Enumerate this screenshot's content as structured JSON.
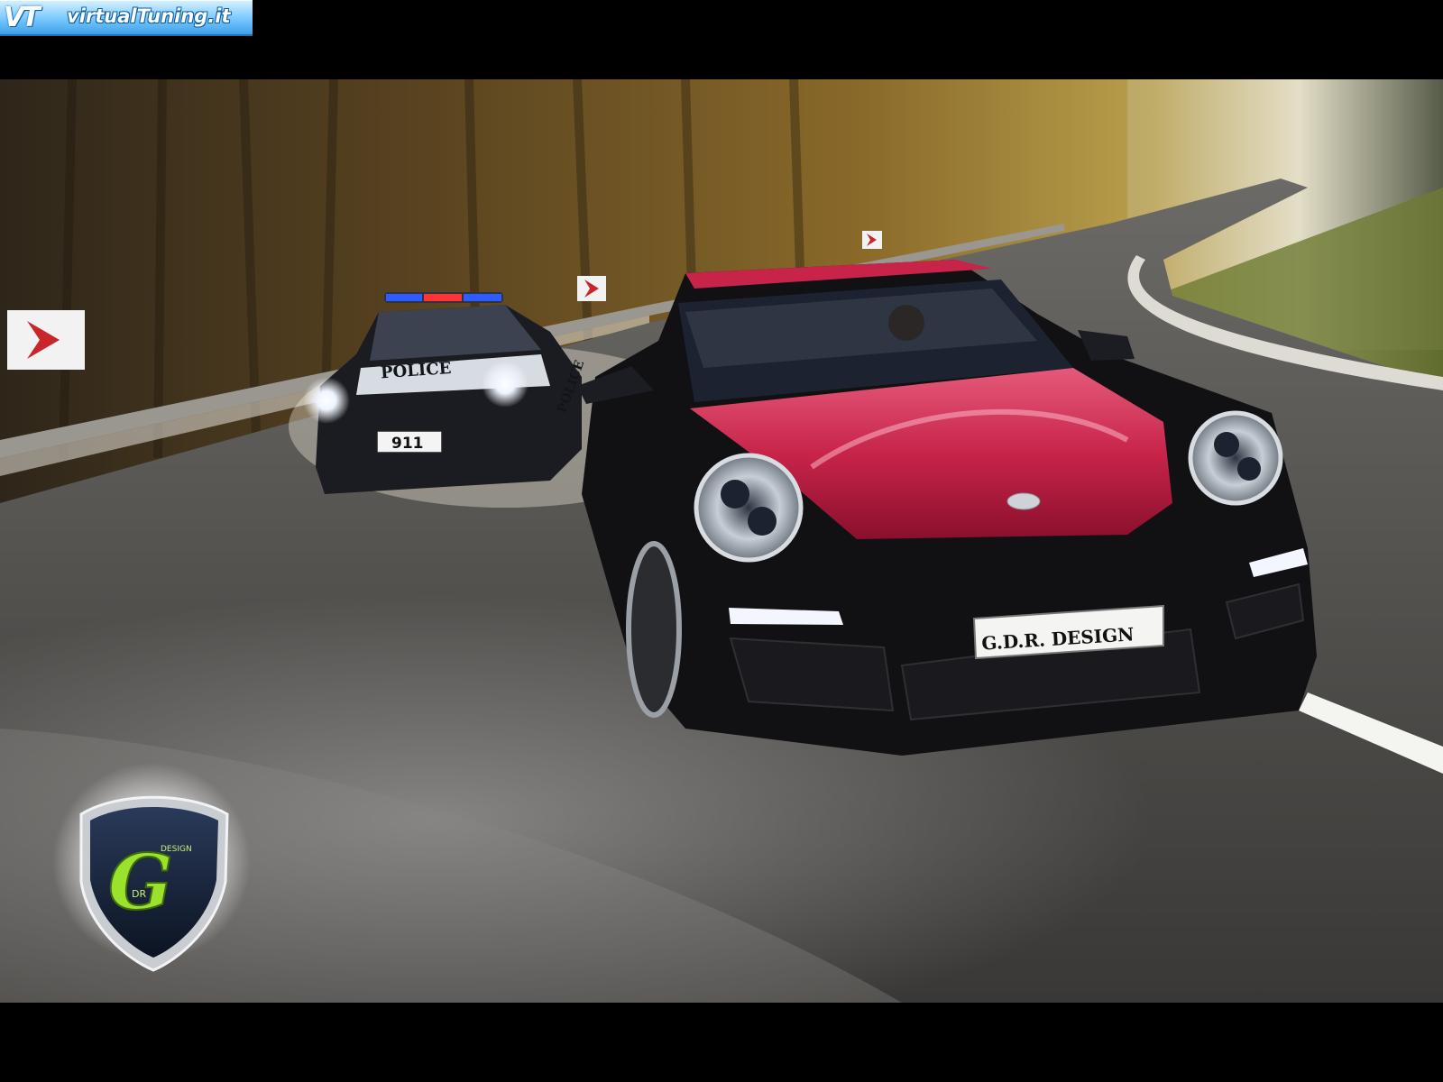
{
  "watermark": {
    "logo_mark": "VT",
    "site_name": "virtualTuning.it"
  },
  "photo": {
    "subject": "",
    "police_plate": "911",
    "police_livery": "POLICE",
    "police_livery_side": "POLICE",
    "front_plate": "G.D.R. DESIGN",
    "badge": {
      "letter": "G",
      "small_top": "DESIGN",
      "small_bottom": "DR"
    }
  },
  "colors": {
    "hood_red": "#c8244a",
    "body_black": "#111114",
    "badge_green": "#9be22c",
    "foliage": "#8a6a2a"
  }
}
